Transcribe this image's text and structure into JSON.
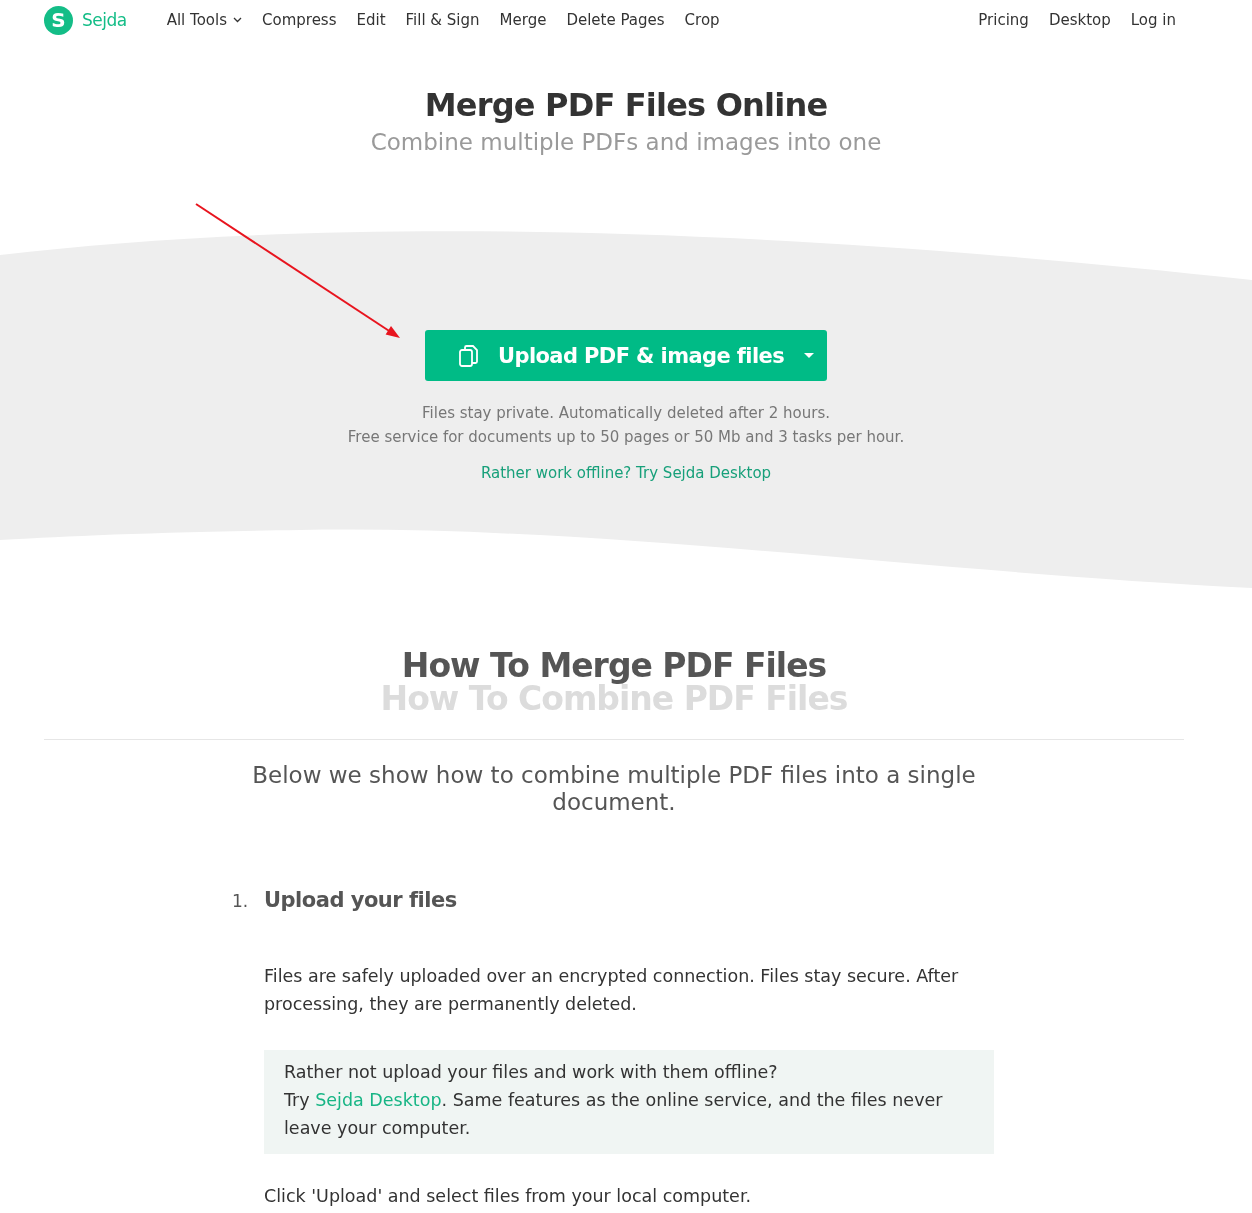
{
  "header": {
    "logo_letter": "S",
    "brand": "Sejda",
    "nav": [
      {
        "label": "All Tools",
        "dropdown": true
      },
      {
        "label": "Compress",
        "dropdown": false
      },
      {
        "label": "Edit",
        "dropdown": false
      },
      {
        "label": "Fill & Sign",
        "dropdown": false
      },
      {
        "label": "Merge",
        "dropdown": false
      },
      {
        "label": "Delete Pages",
        "dropdown": false
      },
      {
        "label": "Crop",
        "dropdown": false
      }
    ],
    "nav_right": [
      "Pricing",
      "Desktop",
      "Log in"
    ]
  },
  "hero": {
    "title": "Merge PDF Files Online",
    "subtitle": "Combine multiple PDFs and images into one",
    "upload_button": "Upload PDF & image files",
    "notes": [
      "Files stay private. Automatically deleted after 2 hours.",
      "Free service for documents up to 50 pages or 50 Mb and 3 tasks per hour."
    ],
    "offline_link": "Rather work offline? Try Sejda Desktop"
  },
  "howto": {
    "title": "How To Merge PDF Files",
    "subtitle": "How To Combine PDF Files",
    "intro": "Below we show how to combine multiple PDF files into a single document.",
    "steps": [
      {
        "number": "1.",
        "title": "Upload your files",
        "text": "Files are safely uploaded over an encrypted connection. Files stay secure. After processing, they are permanently deleted.",
        "note": {
          "question": "Rather not upload your files and work with them offline?",
          "before_link": "Try ",
          "link": "Sejda Desktop",
          "after_link": ". Same features as the online service, and the files never leave your computer."
        },
        "after": "Click 'Upload' and select files from your local computer."
      }
    ]
  }
}
